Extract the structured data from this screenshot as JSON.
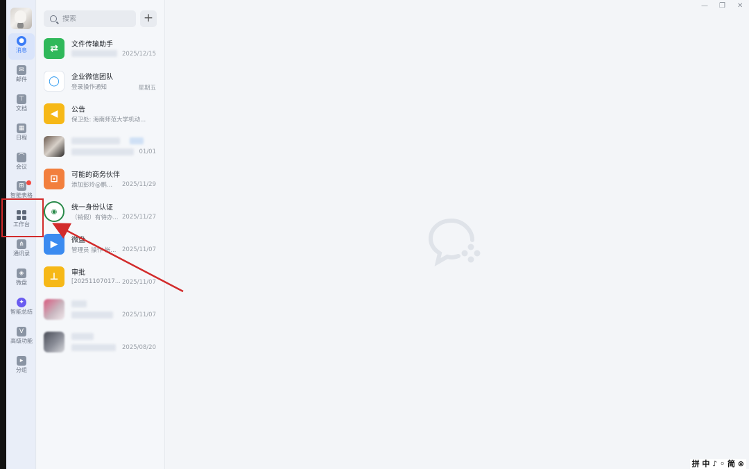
{
  "nav": {
    "items": [
      {
        "label": "消息"
      },
      {
        "label": "邮件"
      },
      {
        "label": "文档"
      },
      {
        "label": "日程"
      },
      {
        "label": "会议"
      },
      {
        "label": "智能表格"
      },
      {
        "label": "工作台"
      },
      {
        "label": "通讯录"
      },
      {
        "label": "微盘"
      },
      {
        "label": "智能总结"
      },
      {
        "label": "高级功能"
      },
      {
        "label": "分组"
      }
    ]
  },
  "search": {
    "placeholder": "搜索"
  },
  "add_label": "+",
  "conversations": [
    {
      "name": "文件传输助手",
      "preview": "",
      "time": "2025/12/15"
    },
    {
      "name": "企业微信团队",
      "preview": "登录操作通知",
      "time": "星期五"
    },
    {
      "name": "公告",
      "preview": "保卫处: 海南师范大学机动...",
      "time": ""
    },
    {
      "name": "",
      "preview": "",
      "time": "01/01"
    },
    {
      "name": "可能的商务伙伴",
      "preview": "添加彭玲@鹏...",
      "time": "2025/11/29"
    },
    {
      "name": "统一身份认证",
      "preview": "（销假）有待办...",
      "time": "2025/11/27"
    },
    {
      "name": "微盘",
      "preview": "管理员 操作 帐...",
      "time": "2025/11/07"
    },
    {
      "name": "审批",
      "preview": "[20251107017...",
      "time": "2025/11/07"
    },
    {
      "name": "",
      "preview": "",
      "time": "2025/11/07"
    },
    {
      "name": "",
      "preview": "",
      "time": "2025/08/20"
    }
  ],
  "window": {
    "minimize": "—",
    "restore": "❐",
    "close": "✕"
  },
  "ime": "拼 中 ♪ ◦ 简 ⊗",
  "colors": {
    "accent": "#3b7cf6",
    "highlight": "#d22b2b"
  }
}
